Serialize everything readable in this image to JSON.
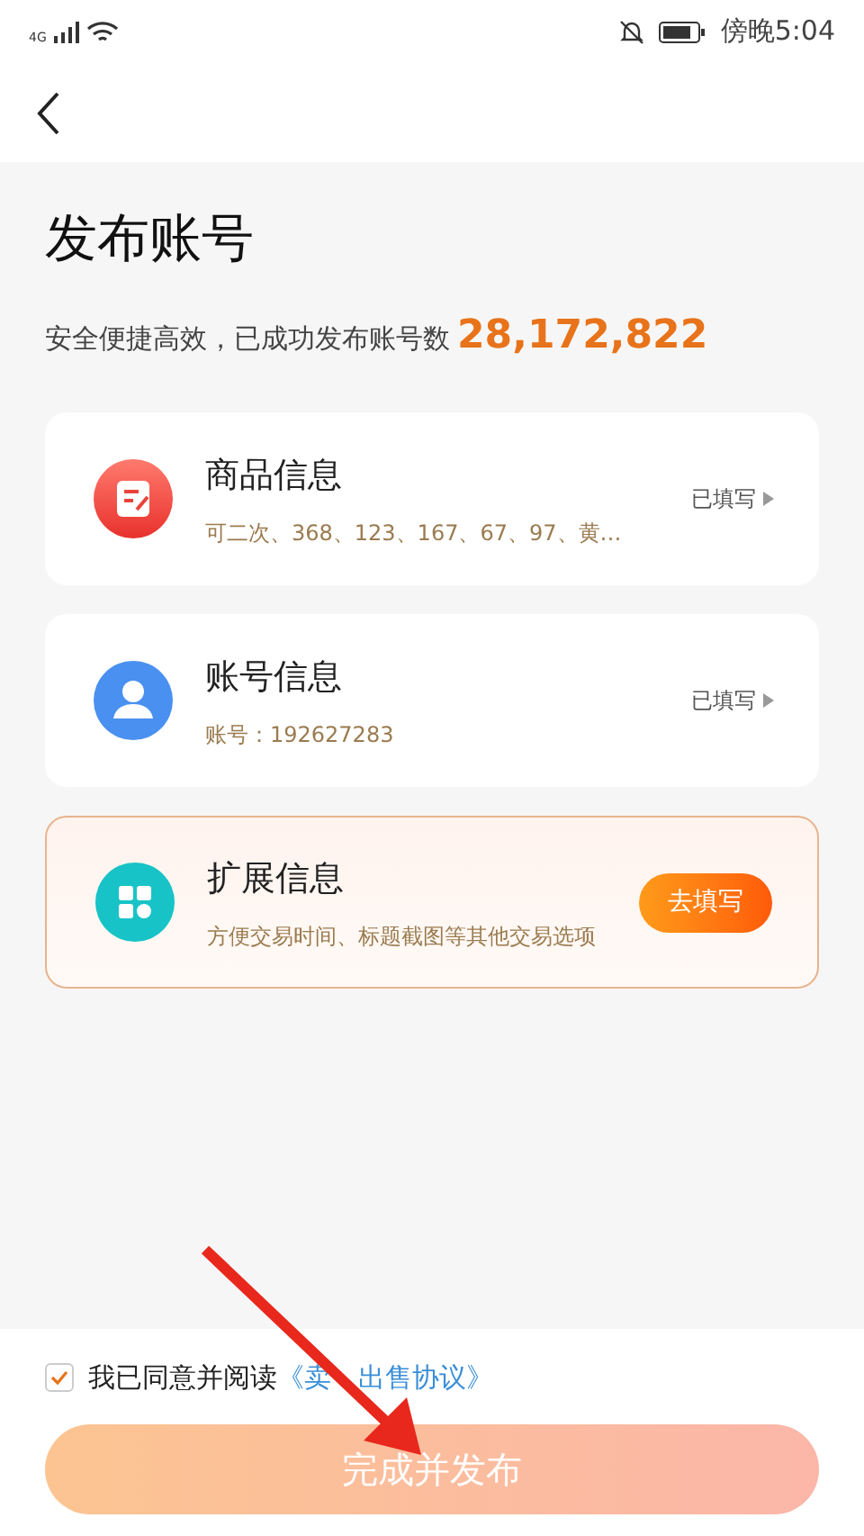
{
  "status_bar": {
    "network": "4G",
    "time": "傍晚5:04"
  },
  "title": "发布账号",
  "subtitle": "安全便捷高效，已成功发布账号数",
  "count": "28,172,822",
  "cards": [
    {
      "kind": "filled",
      "title": "商品信息",
      "detail": "可二次、368、123、167、67、97、黄…",
      "action": "已填写",
      "highlighted": false
    },
    {
      "kind": "filled",
      "title": "账号信息",
      "detail": "账号：192627283",
      "action": "已填写",
      "highlighted": false
    },
    {
      "kind": "todo",
      "title": "扩展信息",
      "detail": "方便交易时间、标题截图等其他交易选项",
      "action": "去填写",
      "highlighted": true
    }
  ],
  "agreement": {
    "checked": true,
    "text": "我已同意并阅读",
    "link_parts": [
      "《卖",
      "出售协议》"
    ]
  },
  "submit": {
    "label": "完成并发布"
  }
}
